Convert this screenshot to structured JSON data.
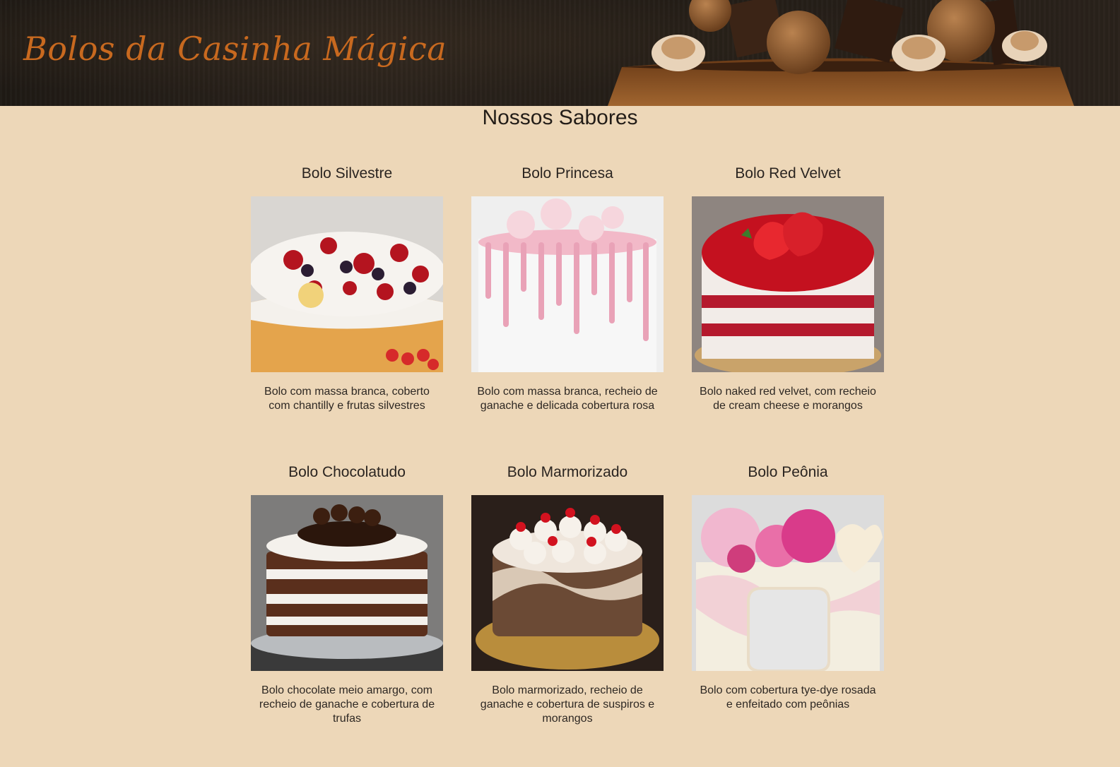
{
  "header": {
    "brand": "Bolos da Casinha Mágica"
  },
  "main": {
    "title": "Nossos Sabores",
    "cakes": [
      {
        "name": "Bolo Silvestre",
        "description": "Bolo com massa branca, coberto com chantilly e frutas silvestres"
      },
      {
        "name": "Bolo Princesa",
        "description": "Bolo com massa branca, recheio de ganache e delicada cobertura rosa"
      },
      {
        "name": "Bolo Red Velvet",
        "description": "Bolo naked red velvet, com recheio de cream cheese e morangos"
      },
      {
        "name": "Bolo Chocolatudo",
        "description": "Bolo chocolate meio amargo, com recheio de ganache e cobertura de trufas"
      },
      {
        "name": "Bolo Marmorizado",
        "description": "Bolo marmorizado, recheio de ganache e cobertura de suspiros e morangos"
      },
      {
        "name": "Bolo Peônia",
        "description": "Bolo com cobertura tye-dye rosada e enfeitado com peônias"
      }
    ]
  }
}
